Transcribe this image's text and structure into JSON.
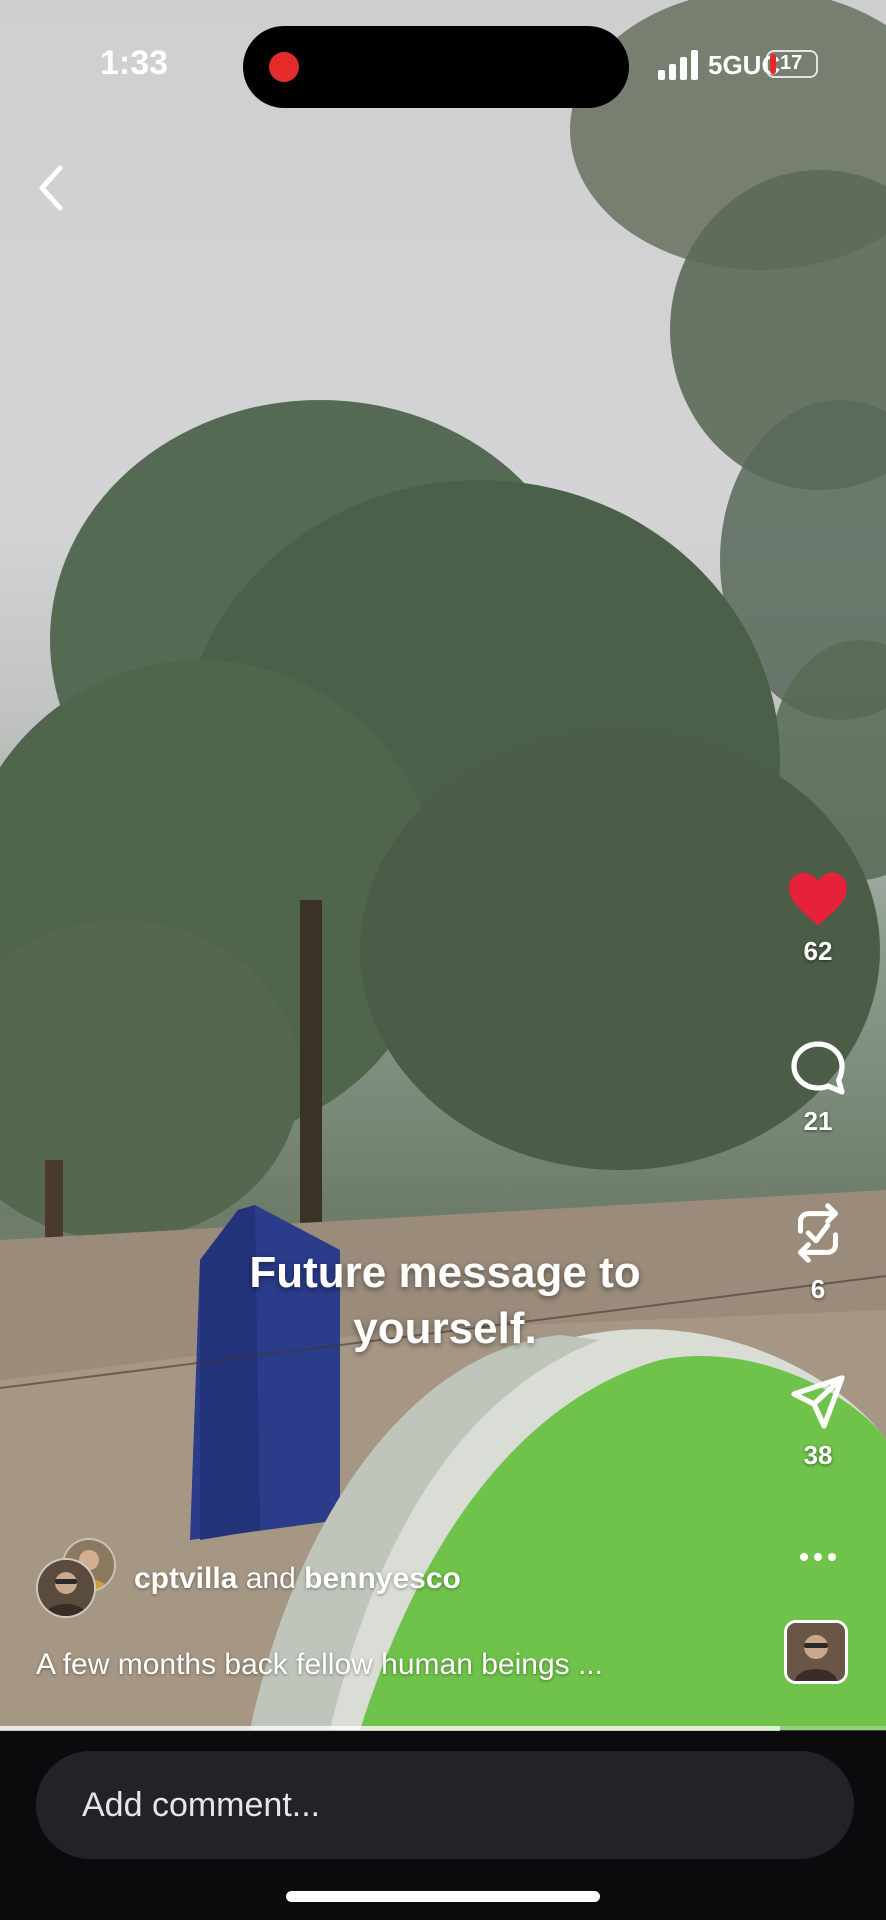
{
  "status_bar": {
    "time": "1:33",
    "network": "5GUC",
    "battery": "17",
    "battery_color": "#e32b2b",
    "recording_color": "#e32b2b"
  },
  "navigation": {
    "back_icon": "chevron-left-icon"
  },
  "video": {
    "overlay_text_line1": "Future message to",
    "overlay_text_line2": "yourself.",
    "progress": 0.88
  },
  "actions": {
    "like": {
      "icon": "heart-icon",
      "count": "62",
      "color": "#e8213b"
    },
    "comment": {
      "icon": "comment-bubble-icon",
      "count": "21"
    },
    "repost": {
      "icon": "repost-icon",
      "count": "6"
    },
    "share": {
      "icon": "send-icon",
      "count": "38"
    },
    "more": {
      "icon": "more-dots-icon",
      "label": "..."
    }
  },
  "post": {
    "author1": "cptvilla",
    "connector": "and",
    "author2": "bennyesco",
    "caption": "A few months back fellow human beings ..."
  },
  "comment_input": {
    "placeholder": "Add comment..."
  }
}
